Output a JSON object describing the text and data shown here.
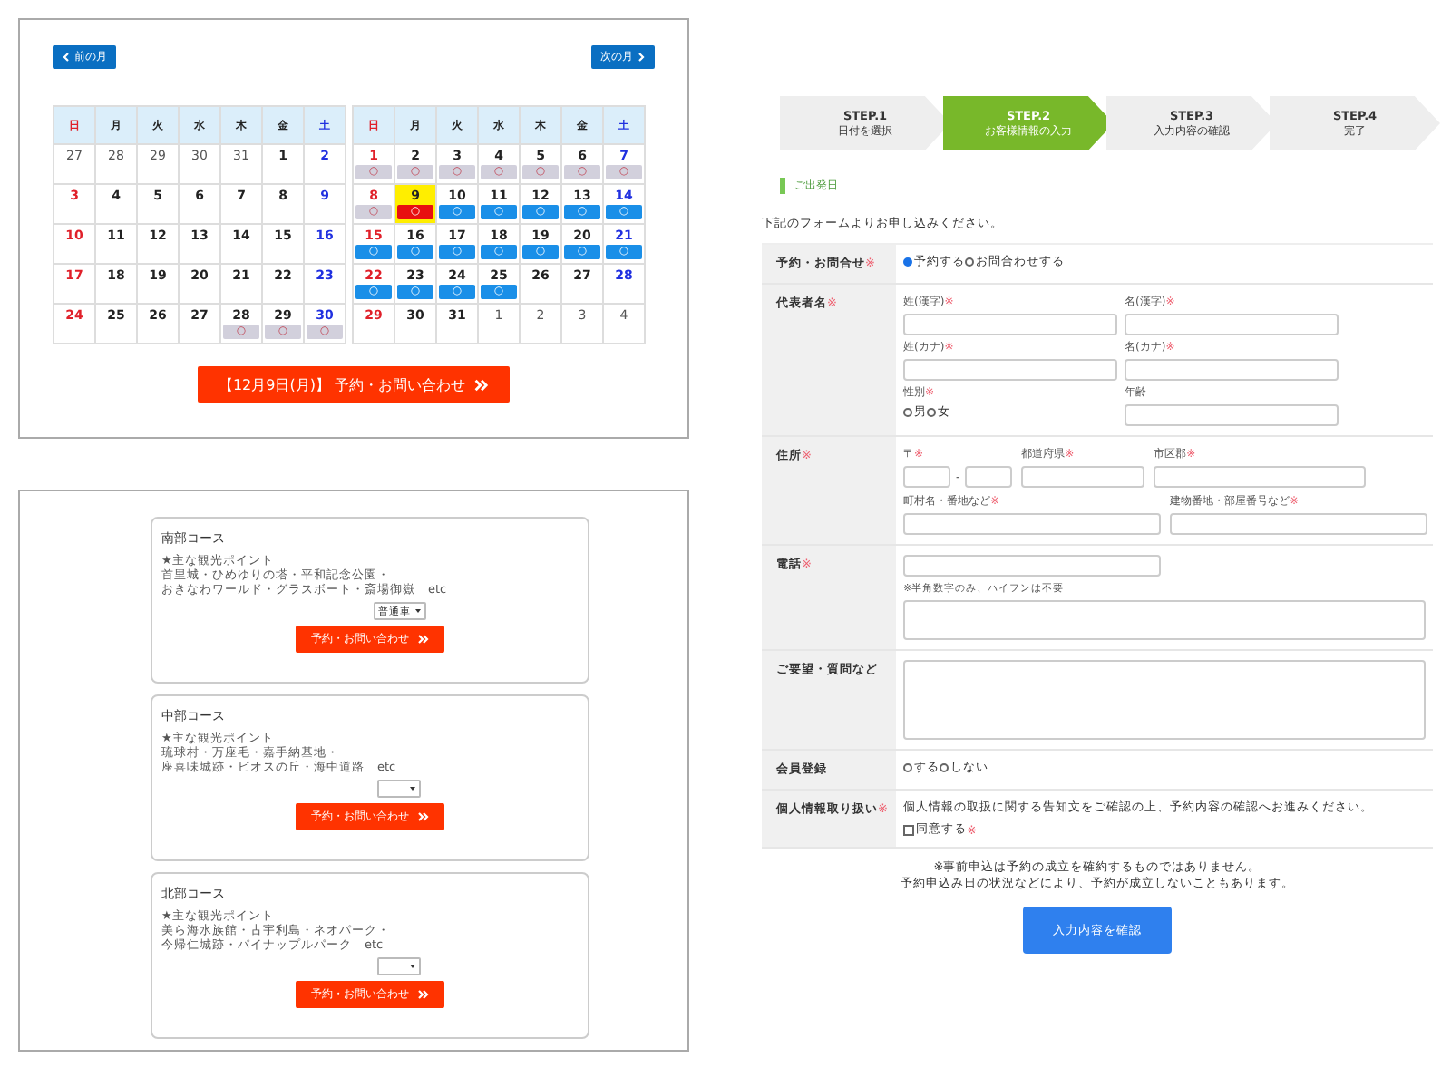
{
  "calendar_panel": {
    "prev_button": "前の月",
    "next_button": "次の月",
    "calendars": [
      {
        "headers": [
          "日",
          "月",
          "火",
          "水",
          "木",
          "金",
          "土"
        ],
        "weeks": [
          [
            {
              "date": "27",
              "outside": true,
              "selected": false
            },
            {
              "date": "28",
              "outside": true,
              "selected": false
            },
            {
              "date": "29",
              "outside": true,
              "selected": false
            },
            {
              "date": "30",
              "outside": true,
              "selected": false
            },
            {
              "date": "31",
              "outside": true,
              "selected": false
            },
            {
              "date": "1",
              "outside": false,
              "selected": false
            },
            {
              "date": "2",
              "outside": false,
              "selected": false
            }
          ],
          [
            {
              "date": "3",
              "outside": false,
              "selected": false
            },
            {
              "date": "4",
              "outside": false,
              "selected": false
            },
            {
              "date": "5",
              "outside": false,
              "selected": false
            },
            {
              "date": "6",
              "outside": false,
              "selected": false
            },
            {
              "date": "7",
              "outside": false,
              "selected": false
            },
            {
              "date": "8",
              "outside": false,
              "selected": false
            },
            {
              "date": "9",
              "outside": false,
              "selected": false
            }
          ],
          [
            {
              "date": "10",
              "outside": false,
              "selected": false
            },
            {
              "date": "11",
              "outside": false,
              "selected": false
            },
            {
              "date": "12",
              "outside": false,
              "selected": false
            },
            {
              "date": "13",
              "outside": false,
              "selected": false
            },
            {
              "date": "14",
              "outside": false,
              "selected": false
            },
            {
              "date": "15",
              "outside": false,
              "selected": false
            },
            {
              "date": "16",
              "outside": false,
              "selected": false
            }
          ],
          [
            {
              "date": "17",
              "outside": false,
              "selected": false
            },
            {
              "date": "18",
              "outside": false,
              "selected": false
            },
            {
              "date": "19",
              "outside": false,
              "selected": false
            },
            {
              "date": "20",
              "outside": false,
              "selected": false
            },
            {
              "date": "21",
              "outside": false,
              "selected": false
            },
            {
              "date": "22",
              "outside": false,
              "selected": false
            },
            {
              "date": "23",
              "outside": false,
              "selected": false
            }
          ],
          [
            {
              "date": "24",
              "outside": false,
              "selected": false
            },
            {
              "date": "25",
              "outside": false,
              "selected": false
            },
            {
              "date": "26",
              "outside": false,
              "selected": false
            },
            {
              "date": "27",
              "outside": false,
              "selected": false
            },
            {
              "date": "28",
              "outside": false,
              "kind": "full",
              "mark": "○",
              "selected": false
            },
            {
              "date": "29",
              "outside": false,
              "kind": "full",
              "mark": "○",
              "selected": false
            },
            {
              "date": "30",
              "outside": false,
              "kind": "full",
              "mark": "○",
              "selected": false
            }
          ]
        ]
      },
      {
        "headers": [
          "日",
          "月",
          "火",
          "水",
          "木",
          "金",
          "土"
        ],
        "weeks": [
          [
            {
              "date": "1",
              "outside": false,
              "kind": "full",
              "mark": "○",
              "selected": false
            },
            {
              "date": "2",
              "outside": false,
              "kind": "full",
              "mark": "○",
              "selected": false
            },
            {
              "date": "3",
              "outside": false,
              "kind": "full",
              "mark": "○",
              "selected": false
            },
            {
              "date": "4",
              "outside": false,
              "kind": "full",
              "mark": "○",
              "selected": false
            },
            {
              "date": "5",
              "outside": false,
              "kind": "full",
              "mark": "○",
              "selected": false
            },
            {
              "date": "6",
              "outside": false,
              "kind": "full",
              "mark": "○",
              "selected": false
            },
            {
              "date": "7",
              "outside": false,
              "kind": "full",
              "mark": "○",
              "selected": false
            }
          ],
          [
            {
              "date": "8",
              "outside": false,
              "kind": "full",
              "mark": "○",
              "selected": false
            },
            {
              "date": "9",
              "outside": false,
              "kind": "open",
              "mark": "○",
              "selected": true
            },
            {
              "date": "10",
              "outside": false,
              "kind": "open",
              "mark": "○",
              "selected": false
            },
            {
              "date": "11",
              "outside": false,
              "kind": "open",
              "mark": "○",
              "selected": false
            },
            {
              "date": "12",
              "outside": false,
              "kind": "open",
              "mark": "○",
              "selected": false
            },
            {
              "date": "13",
              "outside": false,
              "kind": "open",
              "mark": "○",
              "selected": false
            },
            {
              "date": "14",
              "outside": false,
              "kind": "open",
              "mark": "○",
              "selected": false
            }
          ],
          [
            {
              "date": "15",
              "outside": false,
              "kind": "open",
              "mark": "○",
              "selected": false
            },
            {
              "date": "16",
              "outside": false,
              "kind": "open",
              "mark": "○",
              "selected": false
            },
            {
              "date": "17",
              "outside": false,
              "kind": "open",
              "mark": "○",
              "selected": false
            },
            {
              "date": "18",
              "outside": false,
              "kind": "open",
              "mark": "○",
              "selected": false
            },
            {
              "date": "19",
              "outside": false,
              "kind": "open",
              "mark": "○",
              "selected": false
            },
            {
              "date": "20",
              "outside": false,
              "kind": "open",
              "mark": "○",
              "selected": false
            },
            {
              "date": "21",
              "outside": false,
              "kind": "open",
              "mark": "○",
              "selected": false
            }
          ],
          [
            {
              "date": "22",
              "outside": false,
              "kind": "open",
              "mark": "○",
              "selected": false
            },
            {
              "date": "23",
              "outside": false,
              "kind": "open",
              "mark": "○",
              "selected": false
            },
            {
              "date": "24",
              "outside": false,
              "kind": "open",
              "mark": "○",
              "selected": false
            },
            {
              "date": "25",
              "outside": false,
              "kind": "open",
              "mark": "○",
              "selected": false
            },
            {
              "date": "26",
              "outside": false,
              "selected": false
            },
            {
              "date": "27",
              "outside": false,
              "selected": false
            },
            {
              "date": "28",
              "outside": false,
              "selected": false
            }
          ],
          [
            {
              "date": "29",
              "outside": false,
              "selected": false
            },
            {
              "date": "30",
              "outside": false,
              "selected": false
            },
            {
              "date": "31",
              "outside": false,
              "selected": false
            },
            {
              "date": "1",
              "outside": true,
              "selected": false
            },
            {
              "date": "2",
              "outside": true,
              "selected": false
            },
            {
              "date": "3",
              "outside": true,
              "selected": false
            },
            {
              "date": "4",
              "outside": true,
              "selected": false
            }
          ]
        ]
      }
    ],
    "reserve_button": "【12月9日(月)】 予約・お問い合わせ"
  },
  "courses": [
    {
      "title": "南部コース",
      "points_title": "★主な観光ポイント",
      "points": [
        "首里城・ひめゆりの塔・平和記念公園・",
        "おきなわワールド・グラスボート・斎場御嶽　etc"
      ],
      "select_value": "普通車",
      "button": "予約・お問い合わせ"
    },
    {
      "title": "中部コース",
      "points_title": "★主な観光ポイント",
      "points": [
        "琉球村・万座毛・嘉手納基地・",
        "座喜味城跡・ビオスの丘・海中道路　etc"
      ],
      "button": "予約・お問い合わせ"
    },
    {
      "title": "北部コース",
      "points_title": "★主な観光ポイント",
      "points": [
        "美ら海水族館・古宇利島・ネオパーク・",
        "今帰仁城跡・パイナップルパーク　etc"
      ],
      "button": "予約・お問い合わせ"
    }
  ],
  "form": {
    "steps": [
      {
        "label": "STEP.1",
        "caption": "日付を選択",
        "selected": false
      },
      {
        "label": "STEP.2",
        "caption": "お客様情報の入力",
        "selected": true
      },
      {
        "label": "STEP.3",
        "caption": "入力内容の確認",
        "selected": false
      },
      {
        "label": "STEP.4",
        "caption": "完了",
        "selected": false
      }
    ],
    "section_title": "ご出発日",
    "intro": "下記のフォームよりお申し込みください。",
    "rows": [
      {
        "kind": "choice",
        "label": "予約・お問合せ",
        "mark": "※",
        "options": [
          {
            "label": "予約する",
            "selected": true
          },
          {
            "label": "お問合わせする",
            "selected": false
          }
        ]
      },
      {
        "kind": "name",
        "label": "代表者名",
        "mark": "※",
        "fields": [
          {
            "label": "姓(漢字)",
            "mark": "※"
          },
          {
            "label": "名(漢字)",
            "mark": "※"
          },
          {
            "label": "姓(カナ)",
            "mark": "※"
          },
          {
            "label": "名(カナ)",
            "mark": "※"
          },
          {
            "label": "性別",
            "mark": "※",
            "options": [
              {
                "label": "男",
                "selected": false
              },
              {
                "label": "女",
                "selected": false
              }
            ]
          },
          {
            "label": "年齢"
          }
        ]
      },
      {
        "kind": "address",
        "label": "住所",
        "mark": "※",
        "postal": {
          "label": "〒",
          "mark": "※",
          "separator": "-"
        },
        "fields": [
          {
            "label": "都道府県",
            "mark": "※"
          },
          {
            "label": "市区郡",
            "mark": "※"
          },
          {
            "label": "町村名・番地など",
            "mark": "※"
          },
          {
            "label": "建物番地・部屋番号など",
            "mark": "※"
          }
        ]
      },
      {
        "kind": "phone",
        "label": "電話",
        "mark": "※",
        "note": "※半角数字のみ、ハイフンは不要"
      },
      {
        "kind": "textarea",
        "label": "ご要望・質問など"
      },
      {
        "kind": "choice",
        "label": "会員登録",
        "options": [
          {
            "label": "する",
            "selected": false
          },
          {
            "label": "しない",
            "selected": false
          }
        ]
      },
      {
        "kind": "consent",
        "label": "個人情報取り扱い",
        "mark": "※",
        "text": "個人情報の取扱に関する告知文をご確認の上、予約内容の確認へお進みください。",
        "checkbox": {
          "label": "同意する",
          "mark": "※",
          "checked": false
        }
      }
    ],
    "notes": [
      "※事前申込は予約の成立を確約するものではありません。",
      "予約申込み日の状況などにより、予約が成立しないこともあります。"
    ],
    "submit": "入力内容を確認"
  }
}
